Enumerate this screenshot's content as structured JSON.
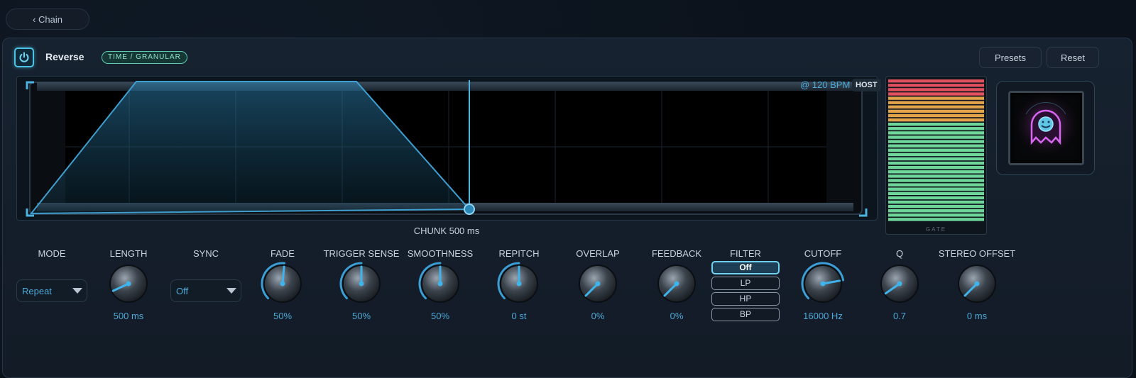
{
  "nav": {
    "back_label": "‹ Chain"
  },
  "header": {
    "effect_name": "Reverse",
    "category": "TIME / GRANULAR",
    "presets_label": "Presets",
    "reset_label": "Reset"
  },
  "display": {
    "tempo_label": "@ 120 BPM",
    "host_label": "HOST",
    "chunk_label": "CHUNK 500 ms",
    "accent_color": "#4da9d8"
  },
  "meter": {
    "label": "GATE",
    "colors": {
      "red": "#e0505e",
      "orange": "#e3a34a",
      "green": "#6fd69a"
    }
  },
  "controls": {
    "mode": {
      "label": "MODE",
      "value": "Repeat"
    },
    "length": {
      "label": "LENGTH",
      "value": "500 ms"
    },
    "sync": {
      "label": "SYNC",
      "value": "Off"
    },
    "fade": {
      "label": "FADE",
      "value": "50%"
    },
    "trigger_sense": {
      "label": "TRIGGER SENSE",
      "value": "50%"
    },
    "smoothness": {
      "label": "SMOOTHNESS",
      "value": "50%"
    },
    "repitch": {
      "label": "REPITCH",
      "value": "0 st"
    },
    "overlap": {
      "label": "OVERLAP",
      "value": "0%"
    },
    "feedback": {
      "label": "FEEDBACK",
      "value": "0%"
    },
    "filter": {
      "label": "FILTER",
      "options": [
        "Off",
        "LP",
        "HP",
        "BP"
      ],
      "selected": "Off"
    },
    "cutoff": {
      "label": "CUTOFF",
      "value": "16000 Hz"
    },
    "q": {
      "label": "Q",
      "value": "0.7"
    },
    "stereo_offset": {
      "label": "STEREO OFFSET",
      "value": "0 ms"
    }
  },
  "icons": {
    "power": "power-icon",
    "chevron": "chevron-down-icon",
    "mascot": "ghost-icon"
  }
}
